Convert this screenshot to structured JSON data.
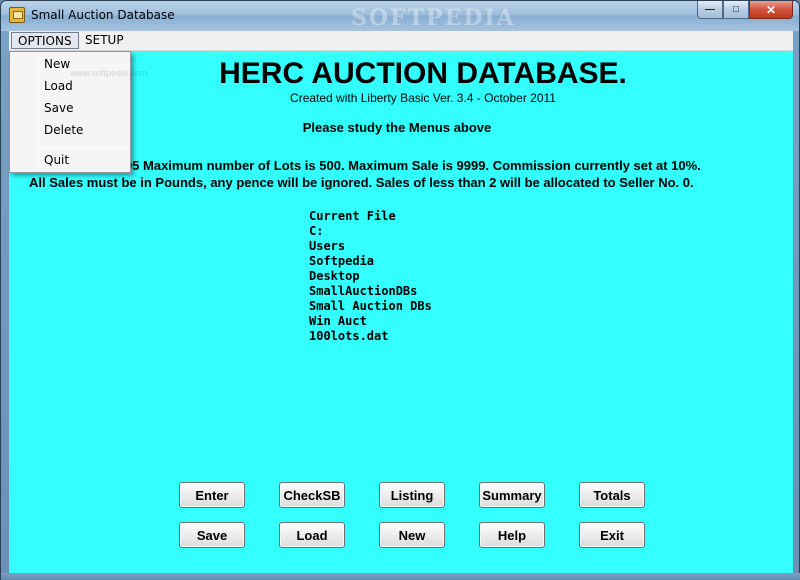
{
  "window": {
    "title": "Small Auction Database",
    "watermark": "SOFTPEDIA",
    "minimize_glyph": "—",
    "maximize_glyph": "□",
    "close_glyph": "✕"
  },
  "menubar": {
    "items": [
      {
        "label": "OPTIONS"
      },
      {
        "label": "SETUP"
      }
    ]
  },
  "options_menu": {
    "items": [
      {
        "label": "New"
      },
      {
        "label": "Load"
      },
      {
        "label": "Save"
      },
      {
        "label": "Delete"
      },
      {
        "label": "Quit"
      }
    ],
    "watermark": "www.softpedia.com"
  },
  "main": {
    "heading": "HERC AUCTION DATABASE.",
    "subtitle": "Created with Liberty Basic Ver. 3.4 - October 2011",
    "instruction": "Please study the Menus above",
    "info_line_1": ": 95 Maximum number of Lots is 500. Maximum Sale is 9999. Commission currently set at  10%.",
    "info_line_2": "All Sales must be in Pounds, any pence will be ignored. Sales of less than 2 will be allocated to Seller No. 0.",
    "current_file": [
      "Current File",
      "C:",
      "Users",
      "Softpedia",
      "Desktop",
      "SmallAuctionDBs",
      "Small Auction DBs",
      "Win Auct",
      "100lots.dat"
    ]
  },
  "buttons": {
    "row1": [
      {
        "label": "Enter"
      },
      {
        "label": "CheckSB"
      },
      {
        "label": "Listing"
      },
      {
        "label": "Summary"
      },
      {
        "label": "Totals"
      }
    ],
    "row2": [
      {
        "label": "Save"
      },
      {
        "label": "Load"
      },
      {
        "label": "New"
      },
      {
        "label": "Help"
      },
      {
        "label": "Exit"
      }
    ]
  },
  "colors": {
    "client_background": "#33ffff",
    "button_face": "#ececec"
  }
}
